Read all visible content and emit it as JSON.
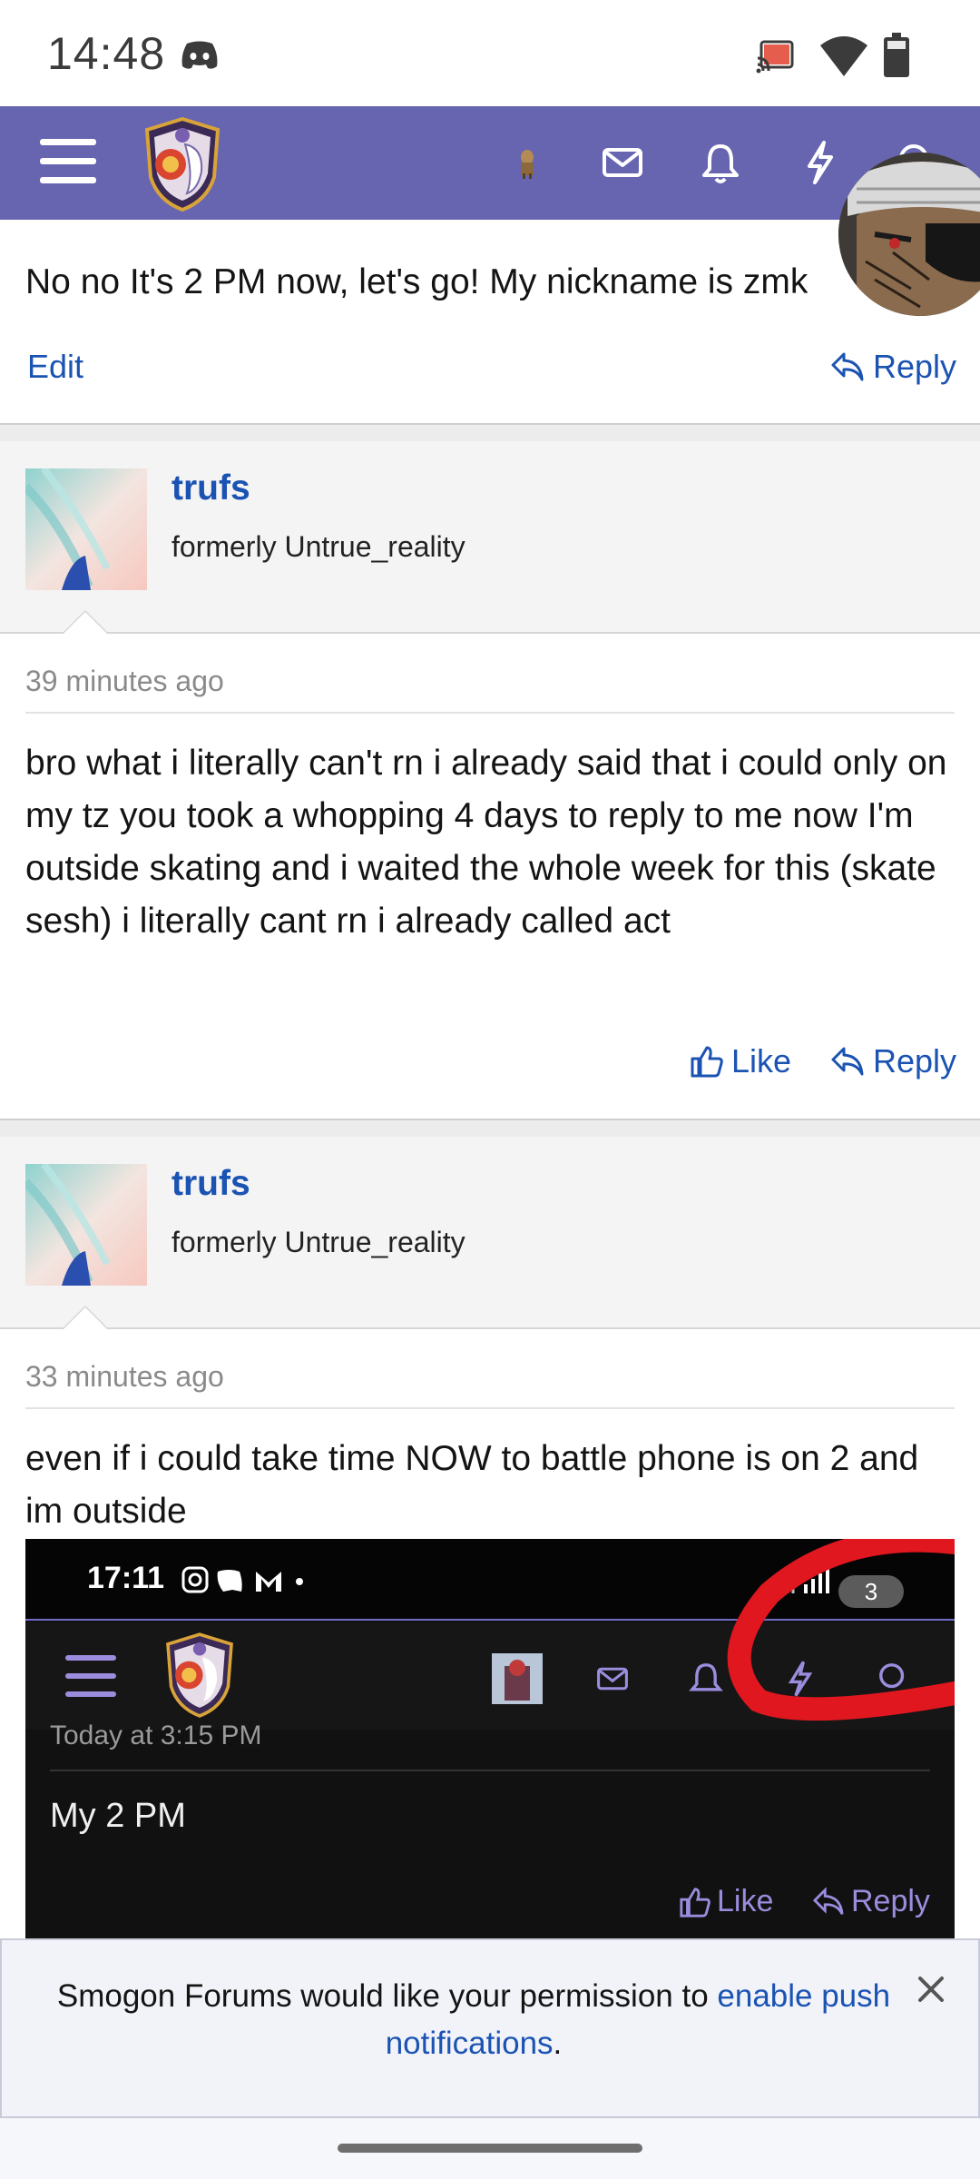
{
  "status_bar": {
    "time": "14:48",
    "icons": [
      "discord-icon",
      "cast-icon",
      "wifi-icon",
      "battery-icon"
    ]
  },
  "header": {
    "icons": [
      "menu-icon",
      "smogon-logo",
      "user-avatar",
      "envelope-icon",
      "bell-icon",
      "bolt-icon",
      "search-icon"
    ],
    "accent_color": "#6765b0"
  },
  "previous_post": {
    "text": "No no It's 2 PM now, let's go! My nickname is zmk",
    "edit_label": "Edit",
    "reply_label": "Reply"
  },
  "posts": [
    {
      "username": "trufs",
      "user_title": "formerly Untrue_reality",
      "timestamp": "39 minutes ago",
      "text": "bro what i literally can't rn i already said that i could only on my tz you took a whopping 4 days to reply to me now I'm outside skating and i waited the whole week for this (skate sesh) i literally cant rn i already called act",
      "like_label": "Like",
      "reply_label": "Reply"
    },
    {
      "username": "trufs",
      "user_title": "formerly Untrue_reality",
      "timestamp": "33 minutes ago",
      "text": "even if i could take time NOW to battle phone is on 2 and im outside"
    }
  ],
  "embedded_screenshot": {
    "time": "17:11",
    "notification_count": "3",
    "timestamp": "Today at 3:15 PM",
    "text": "My 2 PM",
    "like_label": "Like",
    "reply_label": "Reply"
  },
  "notification_banner": {
    "text_before": "Smogon Forums would like your permission to ",
    "link_text": "enable push notifications",
    "text_after": "."
  },
  "colors": {
    "link": "#1b53b3",
    "header": "#6765b0",
    "annotation_red": "#e0171f"
  }
}
